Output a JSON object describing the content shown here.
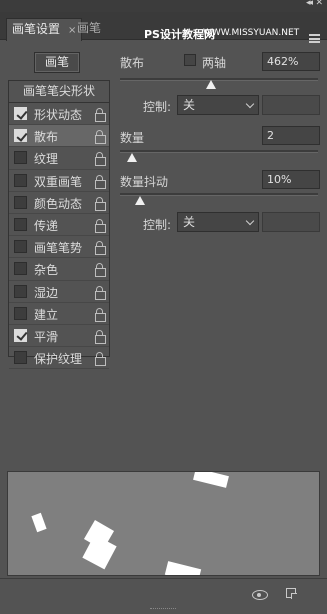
{
  "window": {
    "collapse_glyph": "◂◂",
    "close_glyph": "✕"
  },
  "tabs": [
    {
      "label": "画笔设置",
      "close": "×",
      "active": true
    },
    {
      "label": "画笔",
      "active": false
    }
  ],
  "watermark": {
    "main": "PS设计教程网",
    "sub": "WWW.MISSYUAN.NET"
  },
  "brush_button_label": "画笔",
  "options_header": "画笔笔尖形状",
  "options": [
    {
      "label": "形状动态",
      "checked": true,
      "selected": false
    },
    {
      "label": "散布",
      "checked": true,
      "selected": true
    },
    {
      "label": "纹理",
      "checked": false,
      "selected": false
    },
    {
      "label": "双重画笔",
      "checked": false,
      "selected": false
    },
    {
      "label": "颜色动态",
      "checked": false,
      "selected": false
    },
    {
      "label": "传递",
      "checked": false,
      "selected": false
    },
    {
      "label": "画笔笔势",
      "checked": false,
      "selected": false
    },
    {
      "label": "杂色",
      "checked": false,
      "selected": false
    },
    {
      "label": "湿边",
      "checked": false,
      "selected": false
    },
    {
      "label": "建立",
      "checked": false,
      "selected": false
    },
    {
      "label": "平滑",
      "checked": true,
      "selected": false
    },
    {
      "label": "保护纹理",
      "checked": false,
      "selected": false
    }
  ],
  "scatter": {
    "label": "散布",
    "both_axes_label": "两轴",
    "both_axes_checked": false,
    "value": "462%",
    "value_fraction": 0.462,
    "control_label": "控制:",
    "control_value": "关"
  },
  "count": {
    "label": "数量",
    "value": "2",
    "value_fraction": 0.06
  },
  "count_jitter": {
    "label": "数量抖动",
    "value": "10%",
    "value_fraction": 0.1,
    "control_label": "控制:",
    "control_value": "关"
  },
  "colors": {
    "panel_bg": "#535353",
    "preview_bg": "#7f7f7f",
    "dab": "#ffffff"
  },
  "icons": [
    "menu-icon",
    "lock-icon",
    "checkbox-icon",
    "chevron-down-icon",
    "eye-icon",
    "new-preset-icon"
  ]
}
